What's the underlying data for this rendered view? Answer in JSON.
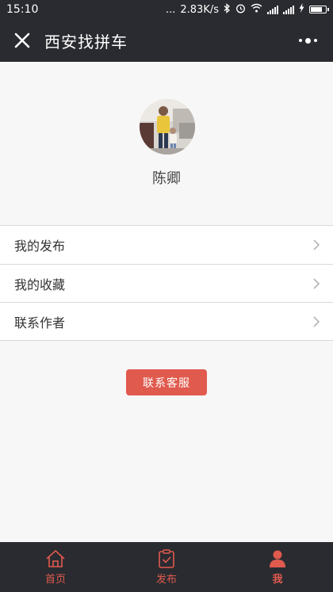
{
  "status_bar": {
    "time": "15:10",
    "network_speed": "2.83K/s",
    "dots": "...",
    "battery_level": 0.7
  },
  "header": {
    "title": "西安找拼车",
    "close_icon": "close-icon",
    "more_icon": "more-icon"
  },
  "profile": {
    "username": "陈卿",
    "avatar_icon": "avatar"
  },
  "menu": {
    "items": [
      {
        "label": "我的发布",
        "icon": "chevron-right-icon"
      },
      {
        "label": "我的收藏",
        "icon": "chevron-right-icon"
      },
      {
        "label": "联系作者",
        "icon": "chevron-right-icon"
      }
    ]
  },
  "service_button": {
    "label": "联系客服"
  },
  "tabbar": {
    "items": [
      {
        "label": "首页",
        "icon": "home-icon",
        "active": false
      },
      {
        "label": "发布",
        "icon": "publish-icon",
        "active": false
      },
      {
        "label": "我",
        "icon": "person-icon",
        "active": true
      }
    ]
  },
  "colors": {
    "dark_bar": "#2a2b30",
    "accent": "#e05a4e",
    "background": "#f7f7f8"
  }
}
